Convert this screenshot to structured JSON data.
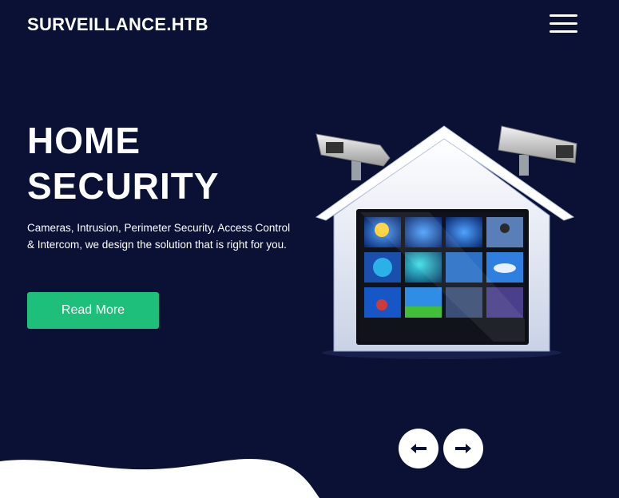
{
  "header": {
    "brand": "SURVEILLANCE.HTB",
    "menu_icon": "hamburger-menu-icon"
  },
  "hero": {
    "title_line1": "HOME",
    "title_line2": "SECURITY",
    "description": "Cameras, Intrusion, Perimeter Security, Access Control & Intercom, we design the solution that is right for you.",
    "read_more_label": "Read More",
    "image": "house-security-cameras-illustration"
  },
  "slider": {
    "prev_icon": "arrow-left-icon",
    "next_icon": "arrow-right-icon"
  },
  "colors": {
    "background": "#0b1135",
    "accent": "#1dbf7a",
    "text": "#ffffff"
  }
}
